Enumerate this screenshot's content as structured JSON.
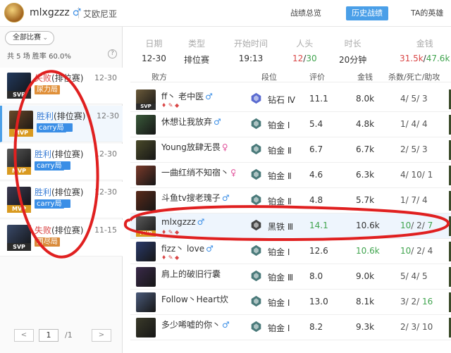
{
  "header": {
    "username": "mlxgzzz",
    "gender": "♂",
    "server": "艾欧尼亚",
    "tabs": [
      {
        "label": "战绩总览",
        "active": false
      },
      {
        "label": "历史战绩",
        "active": true
      },
      {
        "label": "TA的英雄",
        "active": false
      }
    ]
  },
  "sidebar": {
    "filter_label": "全部比赛",
    "stats_text": "共 5 场  胜率 60.0%",
    "help": "?",
    "games": [
      {
        "result": "失败",
        "type": "(排位赛)",
        "date": "12-30",
        "tag": "尿力局",
        "tag_kind": "fail",
        "badge": "SVP",
        "win": false,
        "selected": false
      },
      {
        "result": "胜利",
        "type": "(排位赛)",
        "date": "12-30",
        "tag": "carry局",
        "tag_kind": "carry",
        "badge": "MVP",
        "win": true,
        "selected": true
      },
      {
        "result": "胜利",
        "type": "(排位赛)",
        "date": "12-30",
        "tag": "carry局",
        "tag_kind": "carry",
        "badge": "MVP",
        "win": true,
        "selected": false
      },
      {
        "result": "胜利",
        "type": "(排位赛)",
        "date": "12-30",
        "tag": "carry局",
        "tag_kind": "carry",
        "badge": "MVP",
        "win": true,
        "selected": false
      },
      {
        "result": "失败",
        "type": "(排位赛)",
        "date": "11-15",
        "tag": "用尽局",
        "tag_kind": "assist",
        "badge": "SVP",
        "win": false,
        "selected": false
      }
    ],
    "pager": {
      "prev": "<",
      "next": ">",
      "page": "1",
      "total": "/1"
    }
  },
  "summary": {
    "date_label": "日期",
    "date": "12-30",
    "type_label": "类型",
    "type": "排位赛",
    "start_label": "开始时间",
    "start": "19:13",
    "kills_label": "人头",
    "kills_a": "12",
    "kills_b": "30",
    "duration_label": "时长",
    "duration": "20分钟",
    "gold_label": "金钱",
    "gold_a": "31.5k",
    "gold_b": "47.6k"
  },
  "table": {
    "headers": {
      "team": "败方",
      "rank": "段位",
      "score": "评价",
      "gold": "金钱",
      "kda": "杀数/死亡/助攻"
    },
    "rows": [
      {
        "name": "ff丶 老中医",
        "gender": "♂",
        "rank": "钻石 Ⅳ",
        "score": "11.1",
        "gold": "8.0k",
        "k": "4",
        "d": "5",
        "a": "3",
        "badge": "SVP",
        "me": false
      },
      {
        "name": "休想让我放弃",
        "gender": "♂",
        "rank": "铂金 Ⅰ",
        "score": "5.4",
        "gold": "4.8k",
        "k": "1",
        "d": "4",
        "a": "4",
        "badge": "",
        "me": false
      },
      {
        "name": "Young放肆无畏",
        "gender": "♀",
        "rank": "铂金 Ⅱ",
        "score": "6.7",
        "gold": "6.7k",
        "k": "2",
        "d": "5",
        "a": "3",
        "badge": "",
        "me": false
      },
      {
        "name": "一曲红绡不知宿丶",
        "gender": "♀",
        "rank": "铂金 Ⅱ",
        "score": "4.6",
        "gold": "6.3k",
        "k": "4",
        "d": "10",
        "a": "1",
        "badge": "",
        "me": false
      },
      {
        "name": "斗鱼tv搜老瑰子",
        "gender": "♂",
        "rank": "铂金 Ⅱ",
        "score": "4.8",
        "gold": "5.7k",
        "k": "1",
        "d": "7",
        "a": "4",
        "badge": "",
        "me": false
      },
      {
        "name": "mlxgzzz",
        "gender": "♂",
        "rank": "黑铁 Ⅲ",
        "score": "14.1",
        "gold": "10.6k",
        "k": "10",
        "d": "2",
        "a": "7",
        "badge": "MVP",
        "me": true
      },
      {
        "name": "fizz丶 love",
        "gender": "♂",
        "rank": "铂金 Ⅰ",
        "score": "12.6",
        "gold": "10.6k",
        "k": "10",
        "d": "2",
        "a": "4",
        "badge": "",
        "me": false
      },
      {
        "name": "肩上的破旧行囊",
        "gender": "",
        "rank": "铂金 Ⅲ",
        "score": "8.0",
        "gold": "9.0k",
        "k": "5",
        "d": "4",
        "a": "5",
        "badge": "",
        "me": false
      },
      {
        "name": "Follow丶Heart炊",
        "gender": "",
        "rank": "铂金 Ⅰ",
        "score": "13.0",
        "gold": "8.1k",
        "k": "3",
        "d": "2",
        "a": "16",
        "badge": "",
        "me": false
      },
      {
        "name": "多少唏嘘的你丶",
        "gender": "♂",
        "rank": "铂金 Ⅰ",
        "score": "8.2",
        "gold": "9.3k",
        "k": "2",
        "d": "3",
        "a": "10",
        "badge": "",
        "me": false
      }
    ]
  },
  "colors": {
    "accent": "#4a9fe8",
    "win": "#3d7fd6",
    "lose": "#d94545",
    "annotation": "#e02020",
    "mvp": "#d99a20",
    "green": "#3fa34d"
  }
}
